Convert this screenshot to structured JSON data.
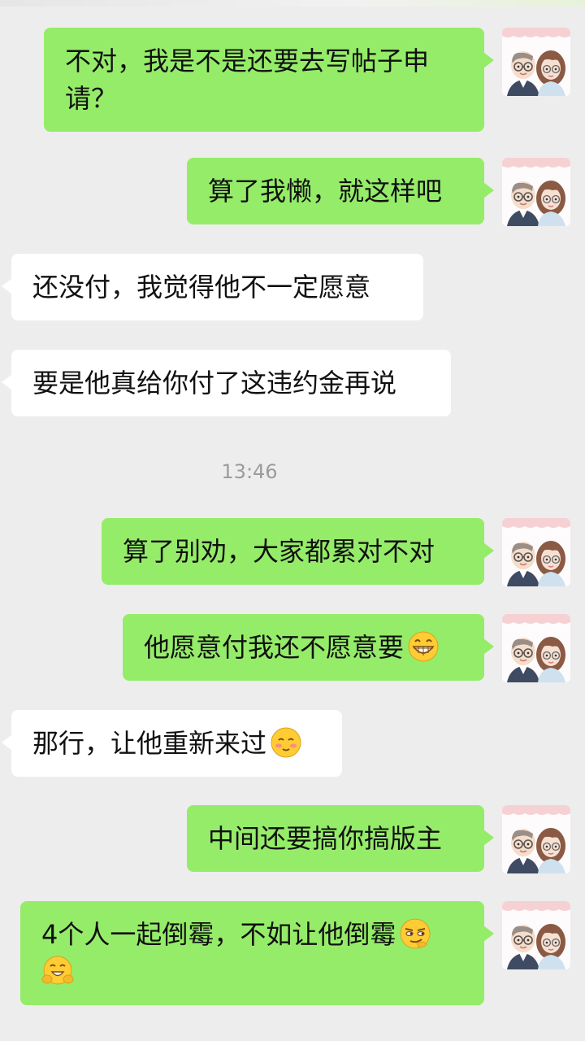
{
  "chat": {
    "time_separator": "13:46",
    "messages": [
      {
        "sender": "me",
        "text": "不对，我是不是还要去写帖子申请？",
        "emoji": ""
      },
      {
        "sender": "me",
        "text": "算了我懒，就这样吧",
        "emoji": ""
      },
      {
        "sender": "them",
        "text": "还没付，我觉得他不一定愿意",
        "emoji": ""
      },
      {
        "sender": "them",
        "text": "要是他真给你付了这违约金再说",
        "emoji": ""
      },
      {
        "sender": "me",
        "text": "算了别劝，大家都累对不对",
        "emoji": ""
      },
      {
        "sender": "me",
        "text": "他愿意付我还不愿意要",
        "emoji": "grin-emoji"
      },
      {
        "sender": "them",
        "text": "那行，让他重新来过",
        "emoji": "blush-emoji"
      },
      {
        "sender": "me",
        "text": "中间还要搞你搞版主",
        "emoji": ""
      },
      {
        "sender": "me",
        "text": "4个人一起倒霉，不如让他倒霉",
        "emoji": "smirk-emoji, hug-emoji"
      }
    ]
  },
  "colors": {
    "background": "#ededed",
    "my_bubble": "#95ec69",
    "their_bubble": "#ffffff",
    "time_text": "#9b9b9b"
  },
  "icons": {
    "avatar": "couple-cartoon-avatar"
  }
}
